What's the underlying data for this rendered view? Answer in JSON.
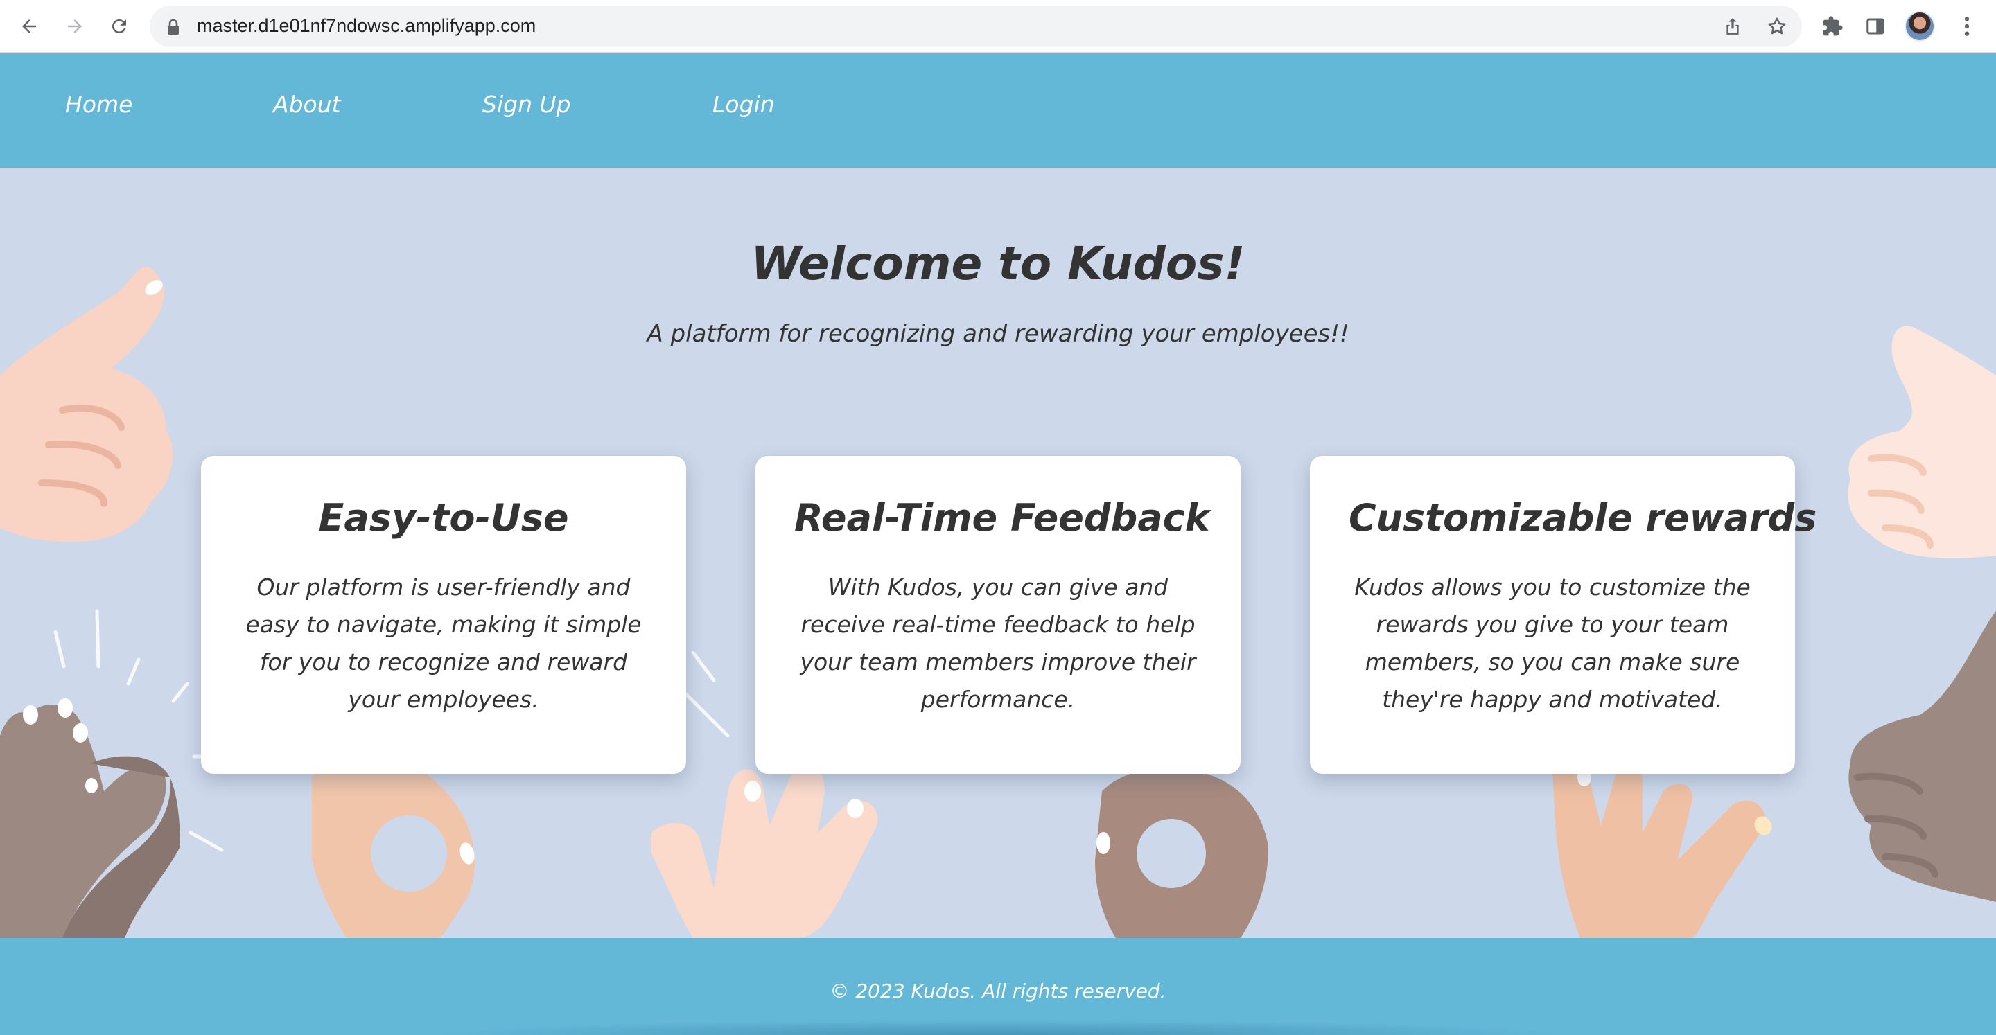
{
  "browser": {
    "url": "master.d1e01nf7ndowsc.amplifyapp.com",
    "icons": {
      "back": "arrow-left-icon",
      "forward": "arrow-right-icon",
      "reload": "reload-icon",
      "lock": "lock-icon",
      "share": "share-icon",
      "bookmark": "star-icon",
      "extensions": "puzzle-icon",
      "side_panel": "side-panel-icon",
      "menu": "kebab-menu-icon"
    }
  },
  "nav": {
    "items": [
      {
        "label": "Home"
      },
      {
        "label": "About"
      },
      {
        "label": "Sign Up"
      },
      {
        "label": "Login"
      }
    ]
  },
  "hero": {
    "title": "Welcome to Kudos!",
    "subtitle": "A platform for recognizing and rewarding your employees!!"
  },
  "features": [
    {
      "title": "Easy-to-Use",
      "text": "Our platform is user-friendly and easy to navigate, making it simple for you to recognize and reward your employees."
    },
    {
      "title": "Real-Time Feedback",
      "text": "With Kudos, you can give and receive real-time feedback to help your team members improve their performance."
    },
    {
      "title": "Customizable rewards",
      "text": "Kudos allows you to customize the rewards you give to your team members, so you can make sure they're happy and motivated."
    }
  ],
  "footer": {
    "copyright": "© 2023 Kudos. All rights reserved."
  },
  "colors": {
    "nav_bg": "#63b7d7",
    "hero_bg": "#cdd8ea",
    "text": "#333333",
    "card_bg": "#ffffff"
  }
}
